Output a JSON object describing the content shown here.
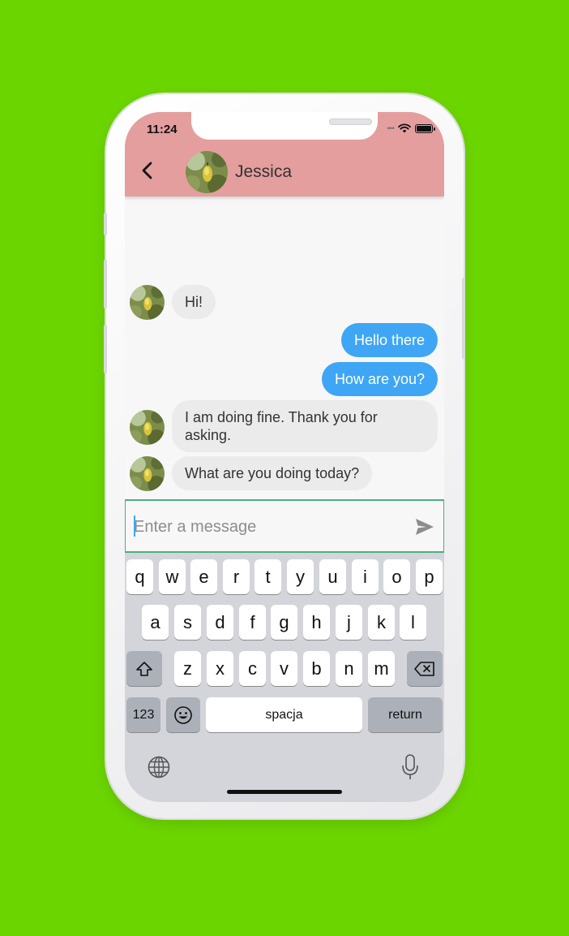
{
  "status_bar": {
    "time": "11:24",
    "signal": "••••"
  },
  "header": {
    "back_icon": "chevron-left-icon",
    "contact_name": "Jessica"
  },
  "messages": [
    {
      "sender": "contact",
      "text": "Hi!"
    },
    {
      "sender": "me",
      "text": "Hello there"
    },
    {
      "sender": "me",
      "text": "How are you?"
    },
    {
      "sender": "contact",
      "text": "I am doing fine. Thank you for asking."
    },
    {
      "sender": "contact",
      "text": "What are you doing today?"
    }
  ],
  "composer": {
    "placeholder": "Enter a message",
    "value": "",
    "send_icon": "send-icon"
  },
  "keyboard": {
    "row1": [
      "q",
      "w",
      "e",
      "r",
      "t",
      "y",
      "u",
      "i",
      "o",
      "p"
    ],
    "row2": [
      "a",
      "s",
      "d",
      "f",
      "g",
      "h",
      "j",
      "k",
      "l"
    ],
    "row3": [
      "z",
      "x",
      "c",
      "v",
      "b",
      "n",
      "m"
    ],
    "numbers_label": "123",
    "space_label": "spacja",
    "return_label": "return",
    "shift_icon": "shift-icon",
    "backspace_icon": "backspace-icon",
    "emoji_icon": "emoji-icon",
    "globe_icon": "globe-icon",
    "mic_icon": "microphone-icon"
  },
  "colors": {
    "background": "#6bd500",
    "header": "#e49e9e",
    "outgoing_bubble": "#3ea6f4",
    "incoming_bubble": "#ebebeb",
    "input_border": "#4caf82"
  }
}
